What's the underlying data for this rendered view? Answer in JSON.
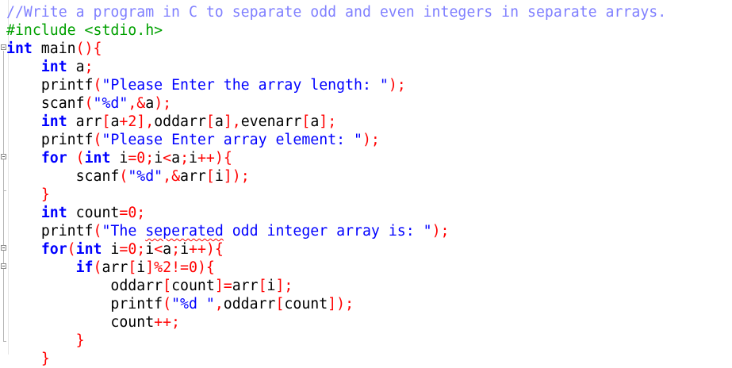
{
  "editor": {
    "lines": [
      {
        "tokens": [
          {
            "t": "//Write a program in C to separate odd and even integers in separate arrays.",
            "c": "cm"
          }
        ]
      },
      {
        "tokens": [
          {
            "t": "#include <stdio.h>",
            "c": "pp"
          }
        ]
      },
      {
        "tokens": [
          {
            "t": "int",
            "c": "kw"
          },
          {
            "t": " main",
            "c": "id"
          },
          {
            "t": "(){",
            "c": "pn"
          }
        ]
      },
      {
        "tokens": [
          {
            "t": "    "
          },
          {
            "t": "int",
            "c": "kw"
          },
          {
            "t": " a",
            "c": "id"
          },
          {
            "t": ";",
            "c": "pn"
          }
        ]
      },
      {
        "tokens": [
          {
            "t": "    "
          },
          {
            "t": "printf",
            "c": "id"
          },
          {
            "t": "(",
            "c": "pn"
          },
          {
            "t": "\"Please Enter the array length: \"",
            "c": "st"
          },
          {
            "t": ");",
            "c": "pn"
          }
        ]
      },
      {
        "tokens": [
          {
            "t": "    "
          },
          {
            "t": "scanf",
            "c": "id"
          },
          {
            "t": "(",
            "c": "pn"
          },
          {
            "t": "\"%d\"",
            "c": "st"
          },
          {
            "t": ",&",
            "c": "pn"
          },
          {
            "t": "a",
            "c": "id"
          },
          {
            "t": ");",
            "c": "pn"
          }
        ]
      },
      {
        "tokens": [
          {
            "t": "    "
          },
          {
            "t": "int",
            "c": "kw"
          },
          {
            "t": " arr",
            "c": "id"
          },
          {
            "t": "[",
            "c": "pn"
          },
          {
            "t": "a",
            "c": "id"
          },
          {
            "t": "+",
            "c": "pn"
          },
          {
            "t": "2",
            "c": "nm"
          },
          {
            "t": "],",
            "c": "pn"
          },
          {
            "t": "oddarr",
            "c": "id"
          },
          {
            "t": "[",
            "c": "pn"
          },
          {
            "t": "a",
            "c": "id"
          },
          {
            "t": "],",
            "c": "pn"
          },
          {
            "t": "evenarr",
            "c": "id"
          },
          {
            "t": "[",
            "c": "pn"
          },
          {
            "t": "a",
            "c": "id"
          },
          {
            "t": "];",
            "c": "pn"
          }
        ]
      },
      {
        "tokens": [
          {
            "t": "    "
          },
          {
            "t": "printf",
            "c": "id"
          },
          {
            "t": "(",
            "c": "pn"
          },
          {
            "t": "\"Please Enter array element: \"",
            "c": "st"
          },
          {
            "t": ");",
            "c": "pn"
          }
        ]
      },
      {
        "tokens": [
          {
            "t": "    "
          },
          {
            "t": "for",
            "c": "kw"
          },
          {
            "t": " ",
            "c": "id"
          },
          {
            "t": "(",
            "c": "pn"
          },
          {
            "t": "int",
            "c": "kw"
          },
          {
            "t": " i",
            "c": "id"
          },
          {
            "t": "=",
            "c": "pn"
          },
          {
            "t": "0",
            "c": "nm"
          },
          {
            "t": ";",
            "c": "pn"
          },
          {
            "t": "i",
            "c": "id"
          },
          {
            "t": "<",
            "c": "pn"
          },
          {
            "t": "a",
            "c": "id"
          },
          {
            "t": ";",
            "c": "pn"
          },
          {
            "t": "i",
            "c": "id"
          },
          {
            "t": "++){",
            "c": "pn"
          }
        ]
      },
      {
        "tokens": [
          {
            "t": "        "
          },
          {
            "t": "scanf",
            "c": "id"
          },
          {
            "t": "(",
            "c": "pn"
          },
          {
            "t": "\"%d\"",
            "c": "st"
          },
          {
            "t": ",&",
            "c": "pn"
          },
          {
            "t": "arr",
            "c": "id"
          },
          {
            "t": "[",
            "c": "pn"
          },
          {
            "t": "i",
            "c": "id"
          },
          {
            "t": "]);",
            "c": "pn"
          }
        ]
      },
      {
        "tokens": [
          {
            "t": "    "
          },
          {
            "t": "}",
            "c": "pn"
          }
        ]
      },
      {
        "tokens": [
          {
            "t": "    "
          },
          {
            "t": "int",
            "c": "kw"
          },
          {
            "t": " count",
            "c": "id"
          },
          {
            "t": "=",
            "c": "pn"
          },
          {
            "t": "0",
            "c": "nm"
          },
          {
            "t": ";",
            "c": "pn"
          }
        ]
      },
      {
        "tokens": [
          {
            "t": "    "
          },
          {
            "t": "printf",
            "c": "id"
          },
          {
            "t": "(",
            "c": "pn"
          },
          {
            "t": "\"The ",
            "c": "st"
          },
          {
            "t": "seperated",
            "c": "st",
            "squig": true
          },
          {
            "t": " odd integer array is: \"",
            "c": "st"
          },
          {
            "t": ");",
            "c": "pn"
          }
        ]
      },
      {
        "tokens": [
          {
            "t": "    "
          },
          {
            "t": "for",
            "c": "kw"
          },
          {
            "t": "(",
            "c": "pn"
          },
          {
            "t": "int",
            "c": "kw"
          },
          {
            "t": " i",
            "c": "id"
          },
          {
            "t": "=",
            "c": "pn"
          },
          {
            "t": "0",
            "c": "nm"
          },
          {
            "t": ";",
            "c": "pn"
          },
          {
            "t": "i",
            "c": "id"
          },
          {
            "t": "<",
            "c": "pn"
          },
          {
            "t": "a",
            "c": "id"
          },
          {
            "t": ";",
            "c": "pn"
          },
          {
            "t": "i",
            "c": "id"
          },
          {
            "t": "++){",
            "c": "pn"
          }
        ]
      },
      {
        "tokens": [
          {
            "t": "        "
          },
          {
            "t": "if",
            "c": "kw"
          },
          {
            "t": "(",
            "c": "pn"
          },
          {
            "t": "arr",
            "c": "id"
          },
          {
            "t": "[",
            "c": "pn"
          },
          {
            "t": "i",
            "c": "id"
          },
          {
            "t": "]%",
            "c": "pn"
          },
          {
            "t": "2",
            "c": "nm"
          },
          {
            "t": "!=",
            "c": "pn"
          },
          {
            "t": "0",
            "c": "nm"
          },
          {
            "t": "){",
            "c": "pn"
          }
        ]
      },
      {
        "tokens": [
          {
            "t": "            "
          },
          {
            "t": "oddarr",
            "c": "id"
          },
          {
            "t": "[",
            "c": "pn"
          },
          {
            "t": "count",
            "c": "id"
          },
          {
            "t": "]=",
            "c": "pn"
          },
          {
            "t": "arr",
            "c": "id"
          },
          {
            "t": "[",
            "c": "pn"
          },
          {
            "t": "i",
            "c": "id"
          },
          {
            "t": "];",
            "c": "pn"
          }
        ]
      },
      {
        "tokens": [
          {
            "t": "            "
          },
          {
            "t": "printf",
            "c": "id"
          },
          {
            "t": "(",
            "c": "pn"
          },
          {
            "t": "\"%d \"",
            "c": "st"
          },
          {
            "t": ",",
            "c": "pn"
          },
          {
            "t": "oddarr",
            "c": "id"
          },
          {
            "t": "[",
            "c": "pn"
          },
          {
            "t": "count",
            "c": "id"
          },
          {
            "t": "]);",
            "c": "pn"
          }
        ]
      },
      {
        "tokens": [
          {
            "t": "            "
          },
          {
            "t": "count",
            "c": "id"
          },
          {
            "t": "++;",
            "c": "pn"
          }
        ]
      },
      {
        "tokens": [
          {
            "t": "        "
          },
          {
            "t": "}",
            "c": "pn"
          }
        ]
      },
      {
        "tokens": [
          {
            "t": "    "
          },
          {
            "t": "}",
            "c": "pn"
          }
        ]
      }
    ]
  }
}
